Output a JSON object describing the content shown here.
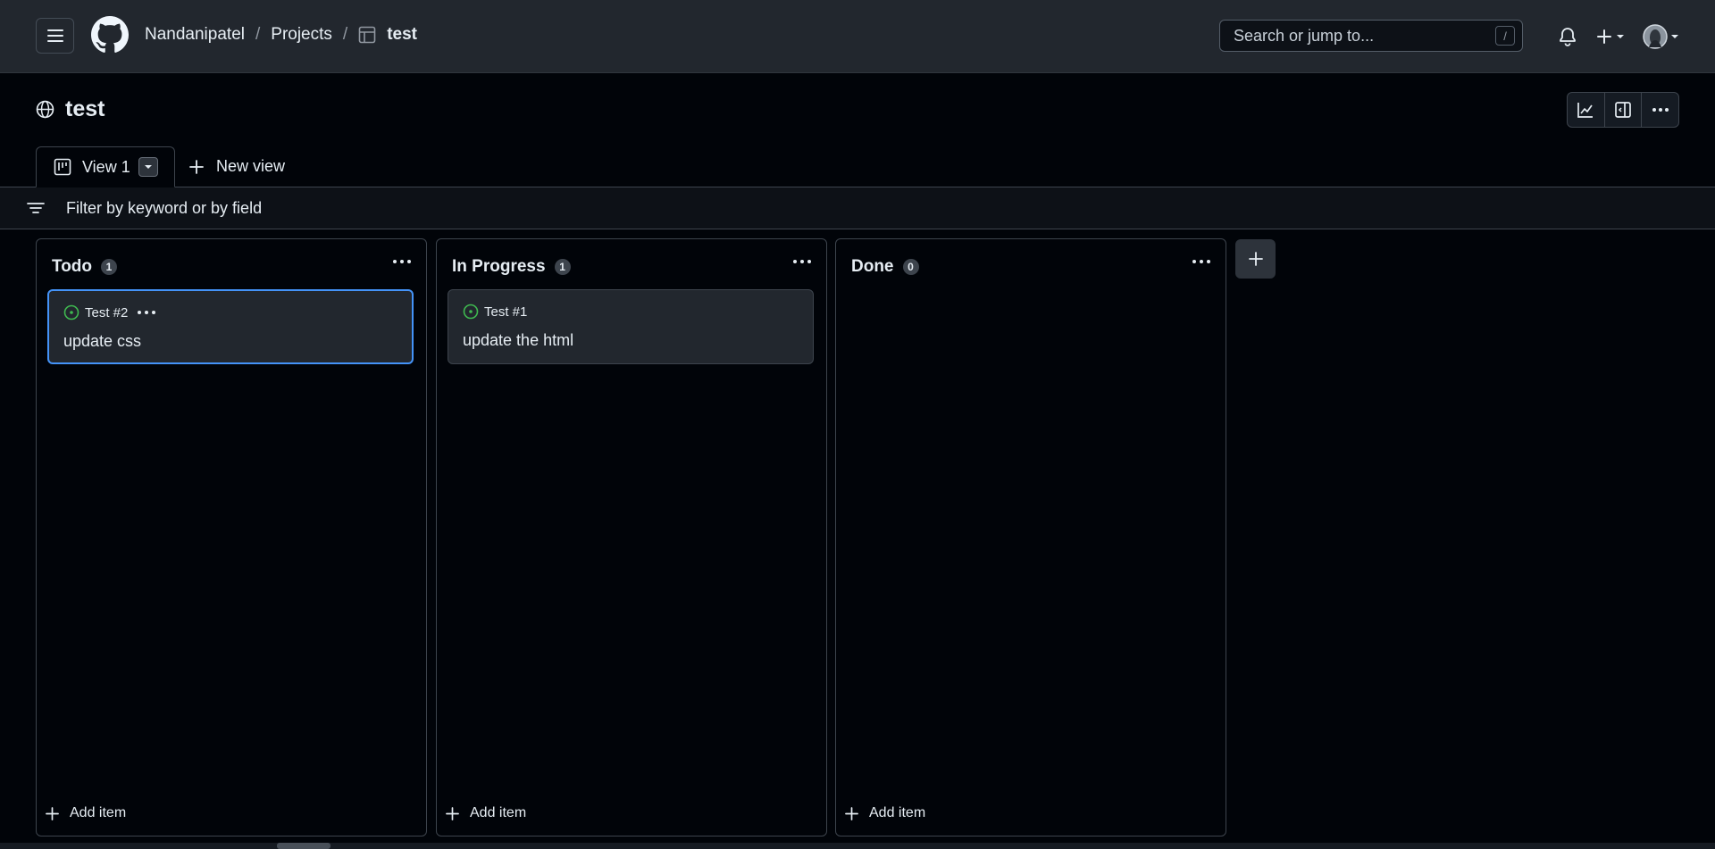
{
  "header": {
    "breadcrumb": [
      "Nandanipatel",
      "Projects",
      "test"
    ],
    "separator": "/",
    "search_placeholder": "Search or jump to...",
    "search_shortcut": "/"
  },
  "project": {
    "title": "test"
  },
  "tabs": {
    "active_label": "View 1",
    "new_view_label": "New view"
  },
  "filter": {
    "placeholder": "Filter by keyword or by field"
  },
  "columns": [
    {
      "name": "Todo",
      "count": "1",
      "cards": [
        {
          "ref": "Test #2",
          "title": "update css",
          "selected": true
        }
      ],
      "add_label": "Add item"
    },
    {
      "name": "In Progress",
      "count": "1",
      "cards": [
        {
          "ref": "Test #1",
          "title": "update the html",
          "selected": false
        }
      ],
      "add_label": "Add item"
    },
    {
      "name": "Done",
      "count": "0",
      "cards": [],
      "add_label": "Add item"
    }
  ],
  "colors": {
    "accent_blue": "#4493f8",
    "issue_open_green": "#3fb950",
    "background": "#010409",
    "header_bg": "#22272e"
  },
  "icons": [
    "hamburger-icon",
    "github-logo-icon",
    "table-icon",
    "bell-icon",
    "plus-icon",
    "avatar",
    "globe-icon",
    "insights-icon",
    "side-panel-icon",
    "kebab-icon",
    "board-icon",
    "triangle-down-icon",
    "filter-icon",
    "issue-open-icon"
  ]
}
